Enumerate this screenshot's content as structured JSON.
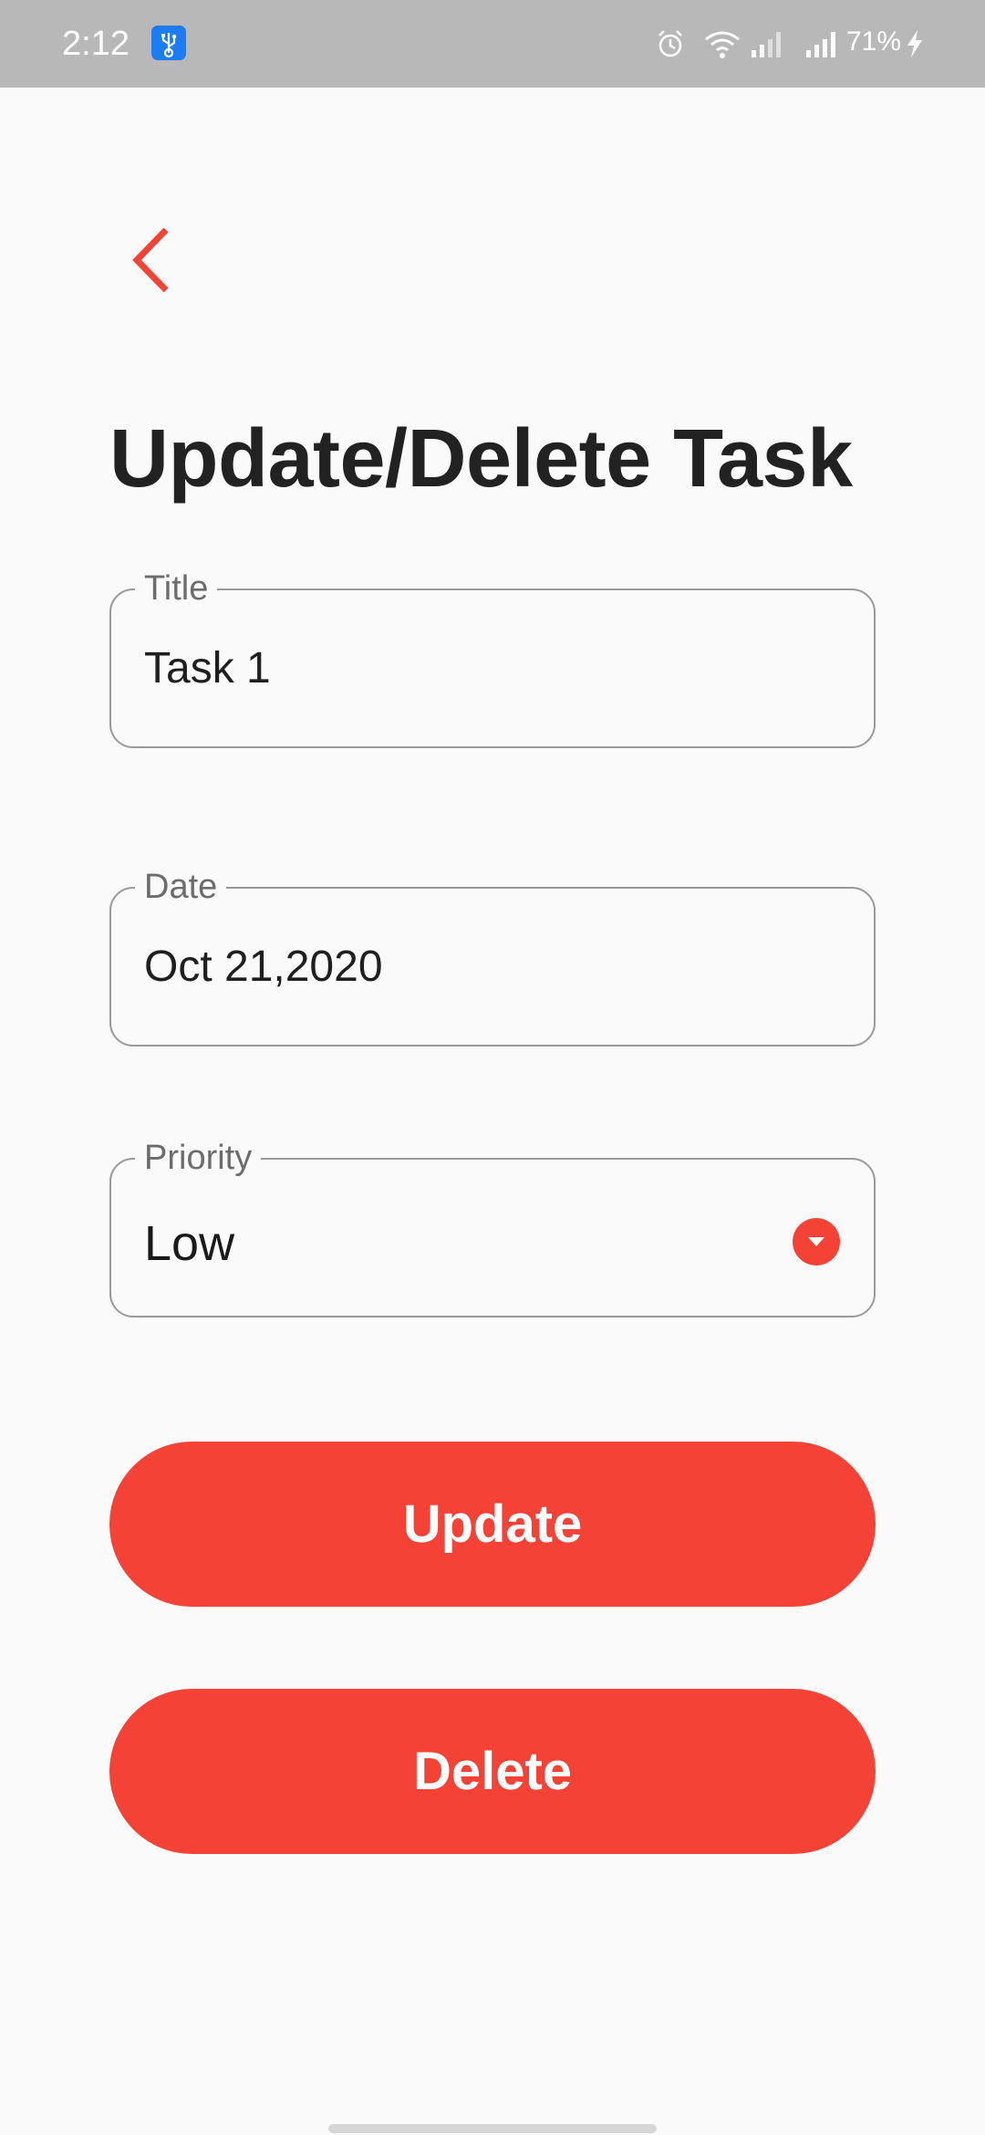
{
  "status_bar": {
    "time": "2:12",
    "battery": "71%",
    "icons": [
      "usb-icon",
      "alarm-icon",
      "wifi-icon",
      "signal-icon",
      "signal-icon",
      "charging-bolt-icon"
    ]
  },
  "header": {
    "back_icon": "chevron-left-icon",
    "title": "Update/Delete Task"
  },
  "form": {
    "title_field": {
      "label": "Title",
      "value": "Task 1"
    },
    "date_field": {
      "label": "Date",
      "value": "Oct 21,2020"
    },
    "priority_field": {
      "label": "Priority",
      "value": "Low",
      "icon": "dropdown-arrow-icon"
    }
  },
  "actions": {
    "update_label": "Update",
    "delete_label": "Delete"
  },
  "colors": {
    "accent": "#f44336",
    "status_bar": "#b8b8b8",
    "background": "#fafafa",
    "title_text": "#222222",
    "border": "#9a9a9a"
  }
}
